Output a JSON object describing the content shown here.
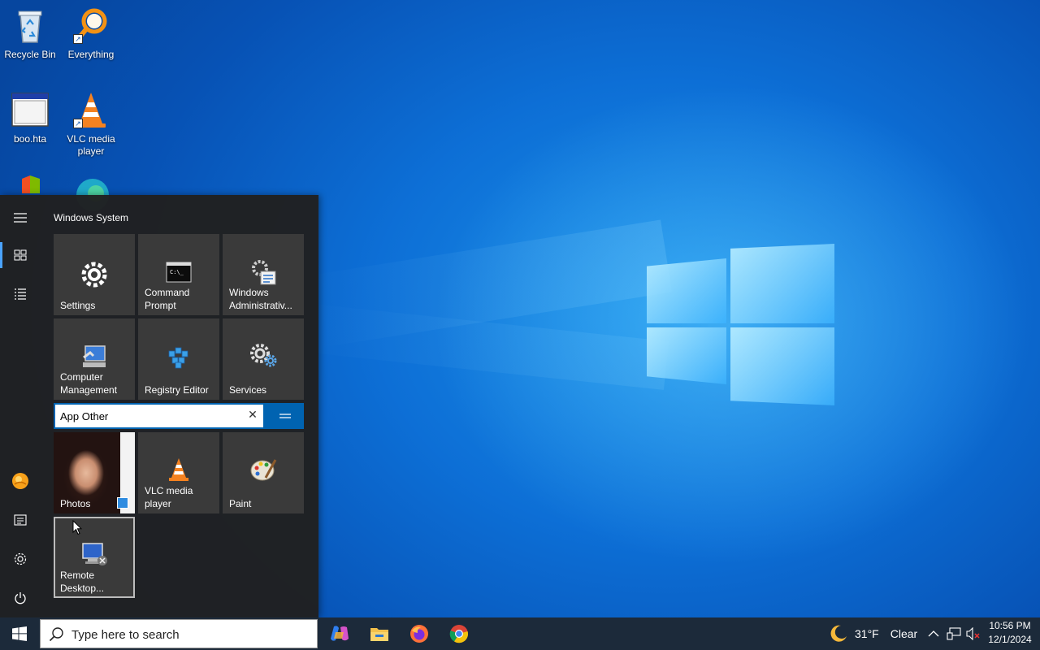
{
  "desktop": {
    "icons": [
      {
        "label": "Recycle Bin",
        "icon": "recycle-bin-icon"
      },
      {
        "label": "Everything",
        "icon": "everything-search-icon"
      },
      {
        "label": "boo.hta",
        "icon": "hta-window-icon"
      },
      {
        "label": "VLC media player",
        "icon": "vlc-cone-icon"
      },
      {
        "label": "",
        "icon": "microsoft-office-icon"
      },
      {
        "label": "",
        "icon": "edge-icon"
      }
    ]
  },
  "start_menu": {
    "rail": [
      {
        "name": "expand",
        "icon": "hamburger-icon"
      },
      {
        "name": "pinned-tiles",
        "icon": "tiles-icon"
      },
      {
        "name": "all-apps",
        "icon": "list-icon"
      },
      {
        "name": "user",
        "icon": "user-avatar-icon"
      },
      {
        "name": "documents",
        "icon": "document-icon"
      },
      {
        "name": "settings",
        "icon": "gear-icon"
      },
      {
        "name": "power",
        "icon": "power-icon"
      }
    ],
    "group1": {
      "title": "Windows System",
      "tiles": [
        {
          "label": "Settings",
          "icon": "gear-icon"
        },
        {
          "label": "Command\nPrompt",
          "icon": "cmd-icon"
        },
        {
          "label": "Windows\nAdministrativ...",
          "icon": "admin-tools-icon"
        },
        {
          "label": "Computer\nManagement",
          "icon": "computer-management-icon"
        },
        {
          "label": "Registry Editor",
          "icon": "registry-icon"
        },
        {
          "label": "Services",
          "icon": "services-gears-icon"
        }
      ]
    },
    "group2": {
      "name_value": "App Other",
      "tiles": [
        {
          "label": "Photos",
          "icon": "photos-icon"
        },
        {
          "label": "VLC media\nplayer",
          "icon": "vlc-cone-icon"
        },
        {
          "label": "Paint",
          "icon": "paint-palette-icon"
        },
        {
          "label": "Remote\nDesktop...",
          "icon": "remote-desktop-icon"
        }
      ]
    }
  },
  "taskbar": {
    "search_placeholder": "Type here to search",
    "apps": [
      {
        "name": "Copilot",
        "icon": "copilot-icon"
      },
      {
        "name": "File Explorer",
        "icon": "folder-icon"
      },
      {
        "name": "Firefox",
        "icon": "firefox-icon"
      },
      {
        "name": "Chrome",
        "icon": "chrome-icon"
      }
    ],
    "weather": {
      "temp": "31°F",
      "condition": "Clear",
      "icon": "moon-icon"
    },
    "clock": {
      "time": "10:56 PM",
      "date": "12/1/2024"
    }
  },
  "colors": {
    "accent": "#0063b1",
    "taskbar": "#1c2a3a",
    "start_bg": "#202020",
    "tile": "#3a3a3a"
  }
}
